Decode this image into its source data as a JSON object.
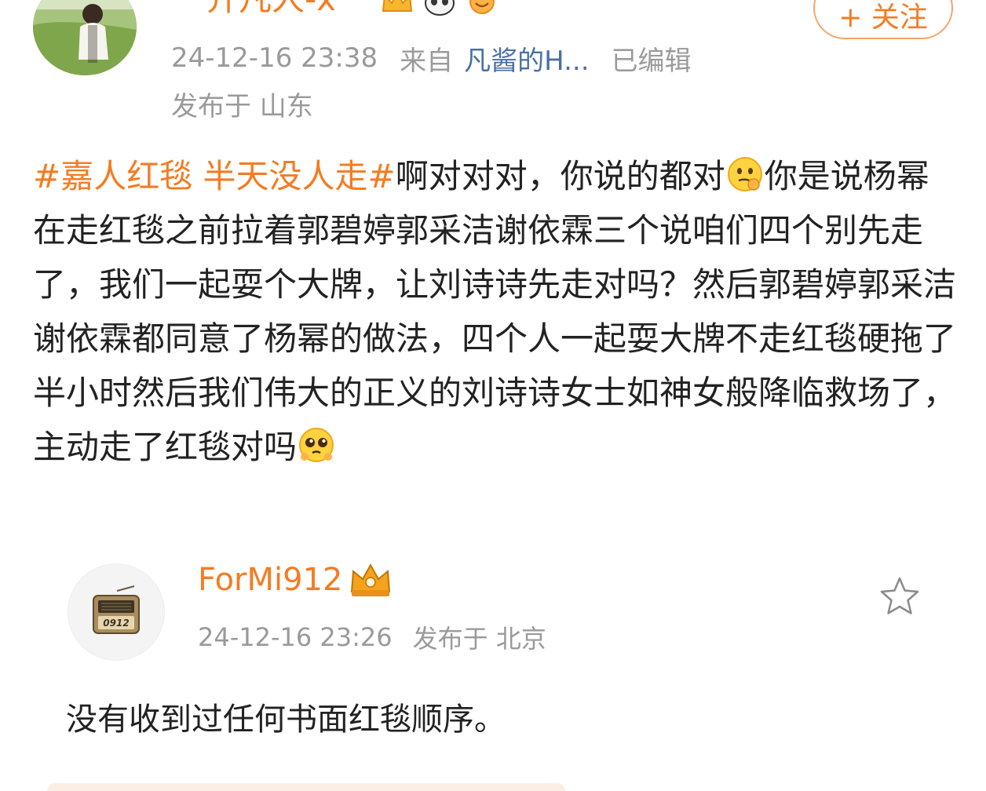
{
  "post": {
    "username": "一介凡人-x",
    "badge_icons": [
      "crown-badge-icon",
      "panda-badge-icon",
      "smile-badge-icon"
    ],
    "follow_label": "+ 关注",
    "timestamp": "24-12-16 23:38",
    "from_label": "来自",
    "source": "凡酱的H...",
    "edited_label": "已编辑",
    "location": "发布于 山东",
    "hashtag": "#嘉人红毯 半天没人走#",
    "text_line1": "啊对对对，你说的都对",
    "text_line2": "你是说杨幂在走红毯之前拉着郭碧婷郭采洁谢依霖三个说咱们四个别先走了，我们一起耍个大牌，让刘诗诗先走对吗？然后郭碧婷郭采洁谢依霖都同意了杨幂的做法，四个人一起耍大牌不走红毯硬拖了半小时然后我们伟大的正义的刘诗诗女士如神女般降临救场了，主动走了红毯对吗",
    "emoji1": "thinking-face-icon",
    "emoji2": "pleading-face-icon"
  },
  "comment": {
    "avatar_label": "0912",
    "username": "ForMi912",
    "timestamp": "24-12-16 23:26",
    "location": "发布于 北京",
    "text": "没有收到过任何书面红毯顺序。"
  },
  "colors": {
    "accent": "#f47c22",
    "link": "#4a6fa5",
    "meta": "#9a9a9a",
    "text": "#222222"
  }
}
